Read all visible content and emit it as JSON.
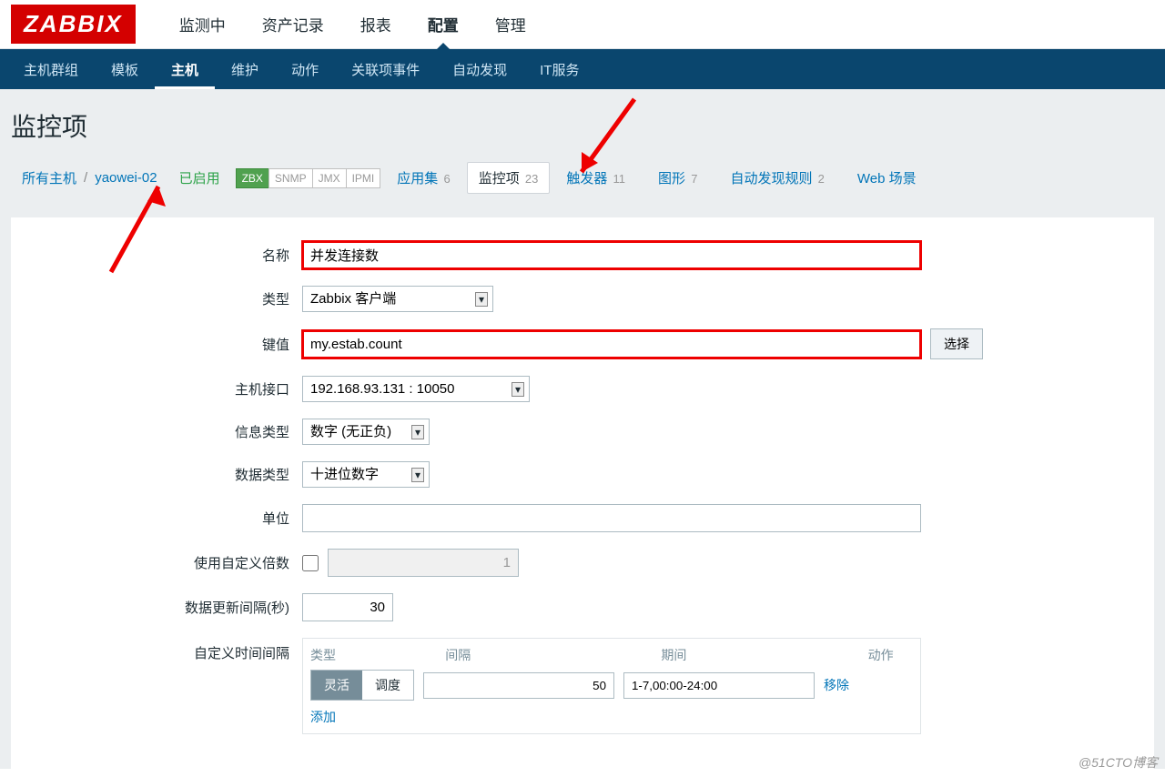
{
  "logo": "ZABBIX",
  "topnav": [
    {
      "label": "监测中"
    },
    {
      "label": "资产记录"
    },
    {
      "label": "报表"
    },
    {
      "label": "配置",
      "active": true
    },
    {
      "label": "管理"
    }
  ],
  "subnav": [
    {
      "label": "主机群组"
    },
    {
      "label": "模板"
    },
    {
      "label": "主机",
      "active": true
    },
    {
      "label": "维护"
    },
    {
      "label": "动作"
    },
    {
      "label": "关联项事件"
    },
    {
      "label": "自动发现"
    },
    {
      "label": "IT服务"
    }
  ],
  "page_title": "监控项",
  "breadcrumb": {
    "all_hosts": "所有主机",
    "sep": "/",
    "host": "yaowei-02",
    "status": "已启用",
    "ifaces": [
      {
        "label": "ZBX",
        "on": true
      },
      {
        "label": "SNMP",
        "on": false
      },
      {
        "label": "JMX",
        "on": false
      },
      {
        "label": "IPMI",
        "on": false
      }
    ],
    "filters": [
      {
        "label": "应用集",
        "count": "6"
      },
      {
        "label": "监控项",
        "count": "23",
        "active": true
      },
      {
        "label": "触发器",
        "count": "11"
      },
      {
        "label": "图形",
        "count": "7"
      },
      {
        "label": "自动发现规则",
        "count": "2"
      },
      {
        "label": "Web 场景",
        "count": ""
      }
    ]
  },
  "form": {
    "name_label": "名称",
    "name_value": "并发连接数",
    "type_label": "类型",
    "type_value": "Zabbix 客户端",
    "key_label": "键值",
    "key_value": "my.estab.count",
    "key_button": "选择",
    "hostif_label": "主机接口",
    "hostif_value": "192.168.93.131 : 10050",
    "info_type_label": "信息类型",
    "info_type_value": "数字 (无正负)",
    "data_type_label": "数据类型",
    "data_type_value": "十进位数字",
    "unit_label": "单位",
    "unit_value": "",
    "mult_label": "使用自定义倍数",
    "mult_value": "1",
    "interval_label": "数据更新间隔(秒)",
    "interval_value": "30",
    "custom_interval_label": "自定义时间间隔",
    "ci": {
      "h1": "类型",
      "h2": "间隔",
      "h3": "期间",
      "h4": "动作",
      "seg_flex": "灵活",
      "seg_sched": "调度",
      "interval": "50",
      "period": "1-7,00:00-24:00",
      "remove": "移除",
      "add": "添加"
    }
  },
  "watermark": "@51CTO博客"
}
